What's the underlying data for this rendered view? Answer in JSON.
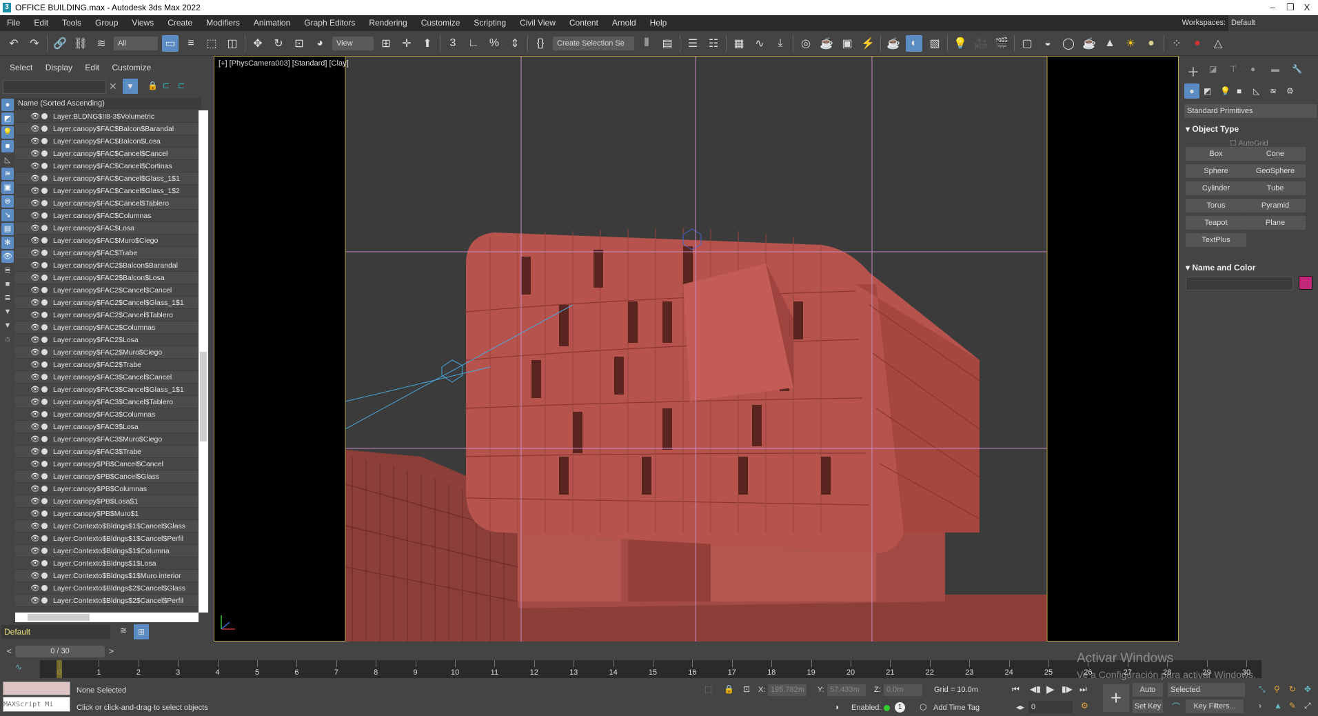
{
  "titlebar": {
    "title": "OFFICE BUILDING.max - Autodesk 3ds Max 2022",
    "app_icon": "3",
    "minimize": "–",
    "restore": "❐",
    "close": "X"
  },
  "menu": [
    "File",
    "Edit",
    "Tools",
    "Group",
    "Views",
    "Create",
    "Modifiers",
    "Animation",
    "Graph Editors",
    "Rendering",
    "Customize",
    "Scripting",
    "Civil View",
    "Content",
    "Arnold",
    "Help"
  ],
  "workspaces": {
    "label": "Workspaces:",
    "value": "Default"
  },
  "toolbar": {
    "filter_value": "All",
    "refcoord_value": "View",
    "selection_set_placeholder": "Create Selection Se"
  },
  "scene_explorer": {
    "tabs": [
      "Select",
      "Display",
      "Edit",
      "Customize"
    ],
    "column_header": "Name (Sorted Ascending)",
    "layer_value": "Default",
    "layers": [
      "Layer:BLDNG$II8-3$Volumetric",
      "Layer:canopy$FAC$Balcon$Barandal",
      "Layer:canopy$FAC$Balcon$Losa",
      "Layer:canopy$FAC$Cancel$Cancel",
      "Layer:canopy$FAC$Cancel$Cortinas",
      "Layer:canopy$FAC$Cancel$Glass_1$1",
      "Layer:canopy$FAC$Cancel$Glass_1$2",
      "Layer:canopy$FAC$Cancel$Tablero",
      "Layer:canopy$FAC$Columnas",
      "Layer:canopy$FAC$Losa",
      "Layer:canopy$FAC$Muro$Ciego",
      "Layer:canopy$FAC$Trabe",
      "Layer:canopy$FAC2$Balcon$Barandal",
      "Layer:canopy$FAC2$Balcon$Losa",
      "Layer:canopy$FAC2$Cancel$Cancel",
      "Layer:canopy$FAC2$Cancel$Glass_1$1",
      "Layer:canopy$FAC2$Cancel$Tablero",
      "Layer:canopy$FAC2$Columnas",
      "Layer:canopy$FAC2$Losa",
      "Layer:canopy$FAC2$Muro$Ciego",
      "Layer:canopy$FAC2$Trabe",
      "Layer:canopy$FAC3$Cancel$Cancel",
      "Layer:canopy$FAC3$Cancel$Glass_1$1",
      "Layer:canopy$FAC3$Cancel$Tablero",
      "Layer:canopy$FAC3$Columnas",
      "Layer:canopy$FAC3$Losa",
      "Layer:canopy$FAC3$Muro$Ciego",
      "Layer:canopy$FAC3$Trabe",
      "Layer:canopy$PB$Cancel$Cancel",
      "Layer:canopy$PB$Cancel$Glass",
      "Layer:canopy$PB$Columnas",
      "Layer:canopy$PB$Losa$1",
      "Layer:canopy$PB$Muro$1",
      "Layer:Contexto$Bldngs$1$Cancel$Glass",
      "Layer:Contexto$Bldngs$1$Cancel$Perfil",
      "Layer:Contexto$Bldngs$1$Columna",
      "Layer:Contexto$Bldngs$1$Losa",
      "Layer:Contexto$Bldngs$1$Muro interior",
      "Layer:Contexto$Bldngs$2$Cancel$Glass",
      "Layer:Contexto$Bldngs$2$Cancel$Perfil"
    ]
  },
  "viewport": {
    "label": "[+] [PhysCamera003] [Standard] [Clay]",
    "building_color": "#b0504a",
    "guide_color": "#c98cc9"
  },
  "command_panel": {
    "category": "Standard Primitives",
    "object_type_title": "Object Type",
    "autogrid": "AutoGrid",
    "buttons": [
      "Box",
      "Cone",
      "Sphere",
      "GeoSphere",
      "Cylinder",
      "Tube",
      "Torus",
      "Pyramid",
      "Teapot",
      "Plane",
      "TextPlus"
    ],
    "name_color_title": "Name and Color",
    "object_color": "#c2287a"
  },
  "timeline": {
    "frame_display": "0 / 30",
    "ticks": [
      "0",
      "1",
      "2",
      "3",
      "4",
      "5",
      "6",
      "7",
      "8",
      "9",
      "10",
      "11",
      "12",
      "13",
      "14",
      "15",
      "16",
      "17",
      "18",
      "19",
      "20",
      "21",
      "22",
      "23",
      "24",
      "25",
      "26",
      "27",
      "28",
      "29",
      "30"
    ]
  },
  "status": {
    "selection": "None Selected",
    "prompt": "Click or click-and-drag to select objects",
    "maxscript_placeholder": "MAXScript Mi",
    "x_label": "X:",
    "x": "195.782m",
    "y_label": "Y:",
    "y": "57.433m",
    "z_label": "Z:",
    "z": "0.0m",
    "grid": "Grid = 10.0m",
    "enabled": "Enabled:",
    "add_time_tag": "Add Time Tag",
    "current_frame": "0",
    "auto_key": "Auto Key",
    "set_key": "Set Key",
    "key_mode": "Selected",
    "key_filters": "Key Filters..."
  },
  "watermark": {
    "line1": "Activar Windows",
    "line2": "Ve a Configuración para activar Windows."
  }
}
